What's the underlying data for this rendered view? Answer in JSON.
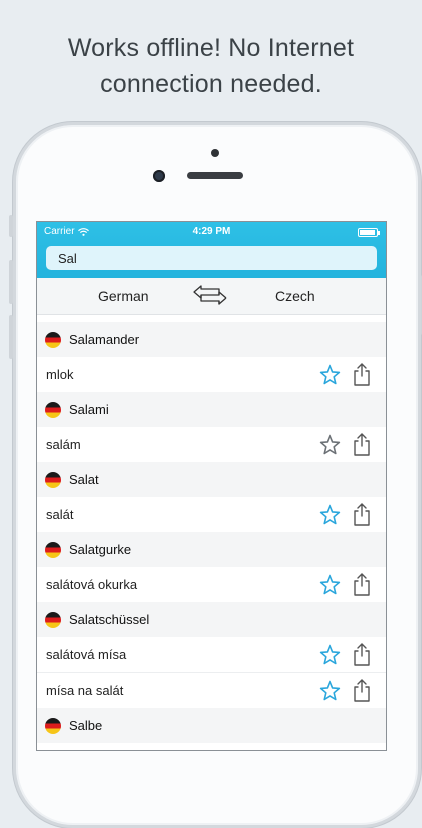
{
  "headline": {
    "line1": "Works offline! No Internet",
    "line2": "connection needed."
  },
  "status_bar": {
    "carrier": "Carrier",
    "time": "4:29 PM"
  },
  "search": {
    "value": "Sal"
  },
  "language_bar": {
    "from": "German",
    "to": "Czech",
    "swap_icon": "swap-arrows-icon"
  },
  "entries": [
    {
      "headword": "Salamander",
      "translations": [
        {
          "text": "mlok",
          "starred": true
        }
      ]
    },
    {
      "headword": "Salami",
      "translations": [
        {
          "text": "salám",
          "starred": false
        }
      ]
    },
    {
      "headword": "Salat",
      "translations": [
        {
          "text": "salát",
          "starred": true
        }
      ]
    },
    {
      "headword": "Salatgurke",
      "translations": [
        {
          "text": "salátová okurka",
          "starred": true
        }
      ]
    },
    {
      "headword": "Salatschüssel",
      "translations": [
        {
          "text": "salátová mísa",
          "starred": true
        },
        {
          "text": "mísa na salát",
          "starred": true
        }
      ]
    },
    {
      "headword": "Salbe",
      "translations": []
    }
  ],
  "colors": {
    "accent": "#25b6df",
    "star_active": "#2aa6dc",
    "star_inactive": "#6c7176",
    "flag": [
      "#1a1a1a",
      "#dd1c1c",
      "#f6c518"
    ]
  }
}
